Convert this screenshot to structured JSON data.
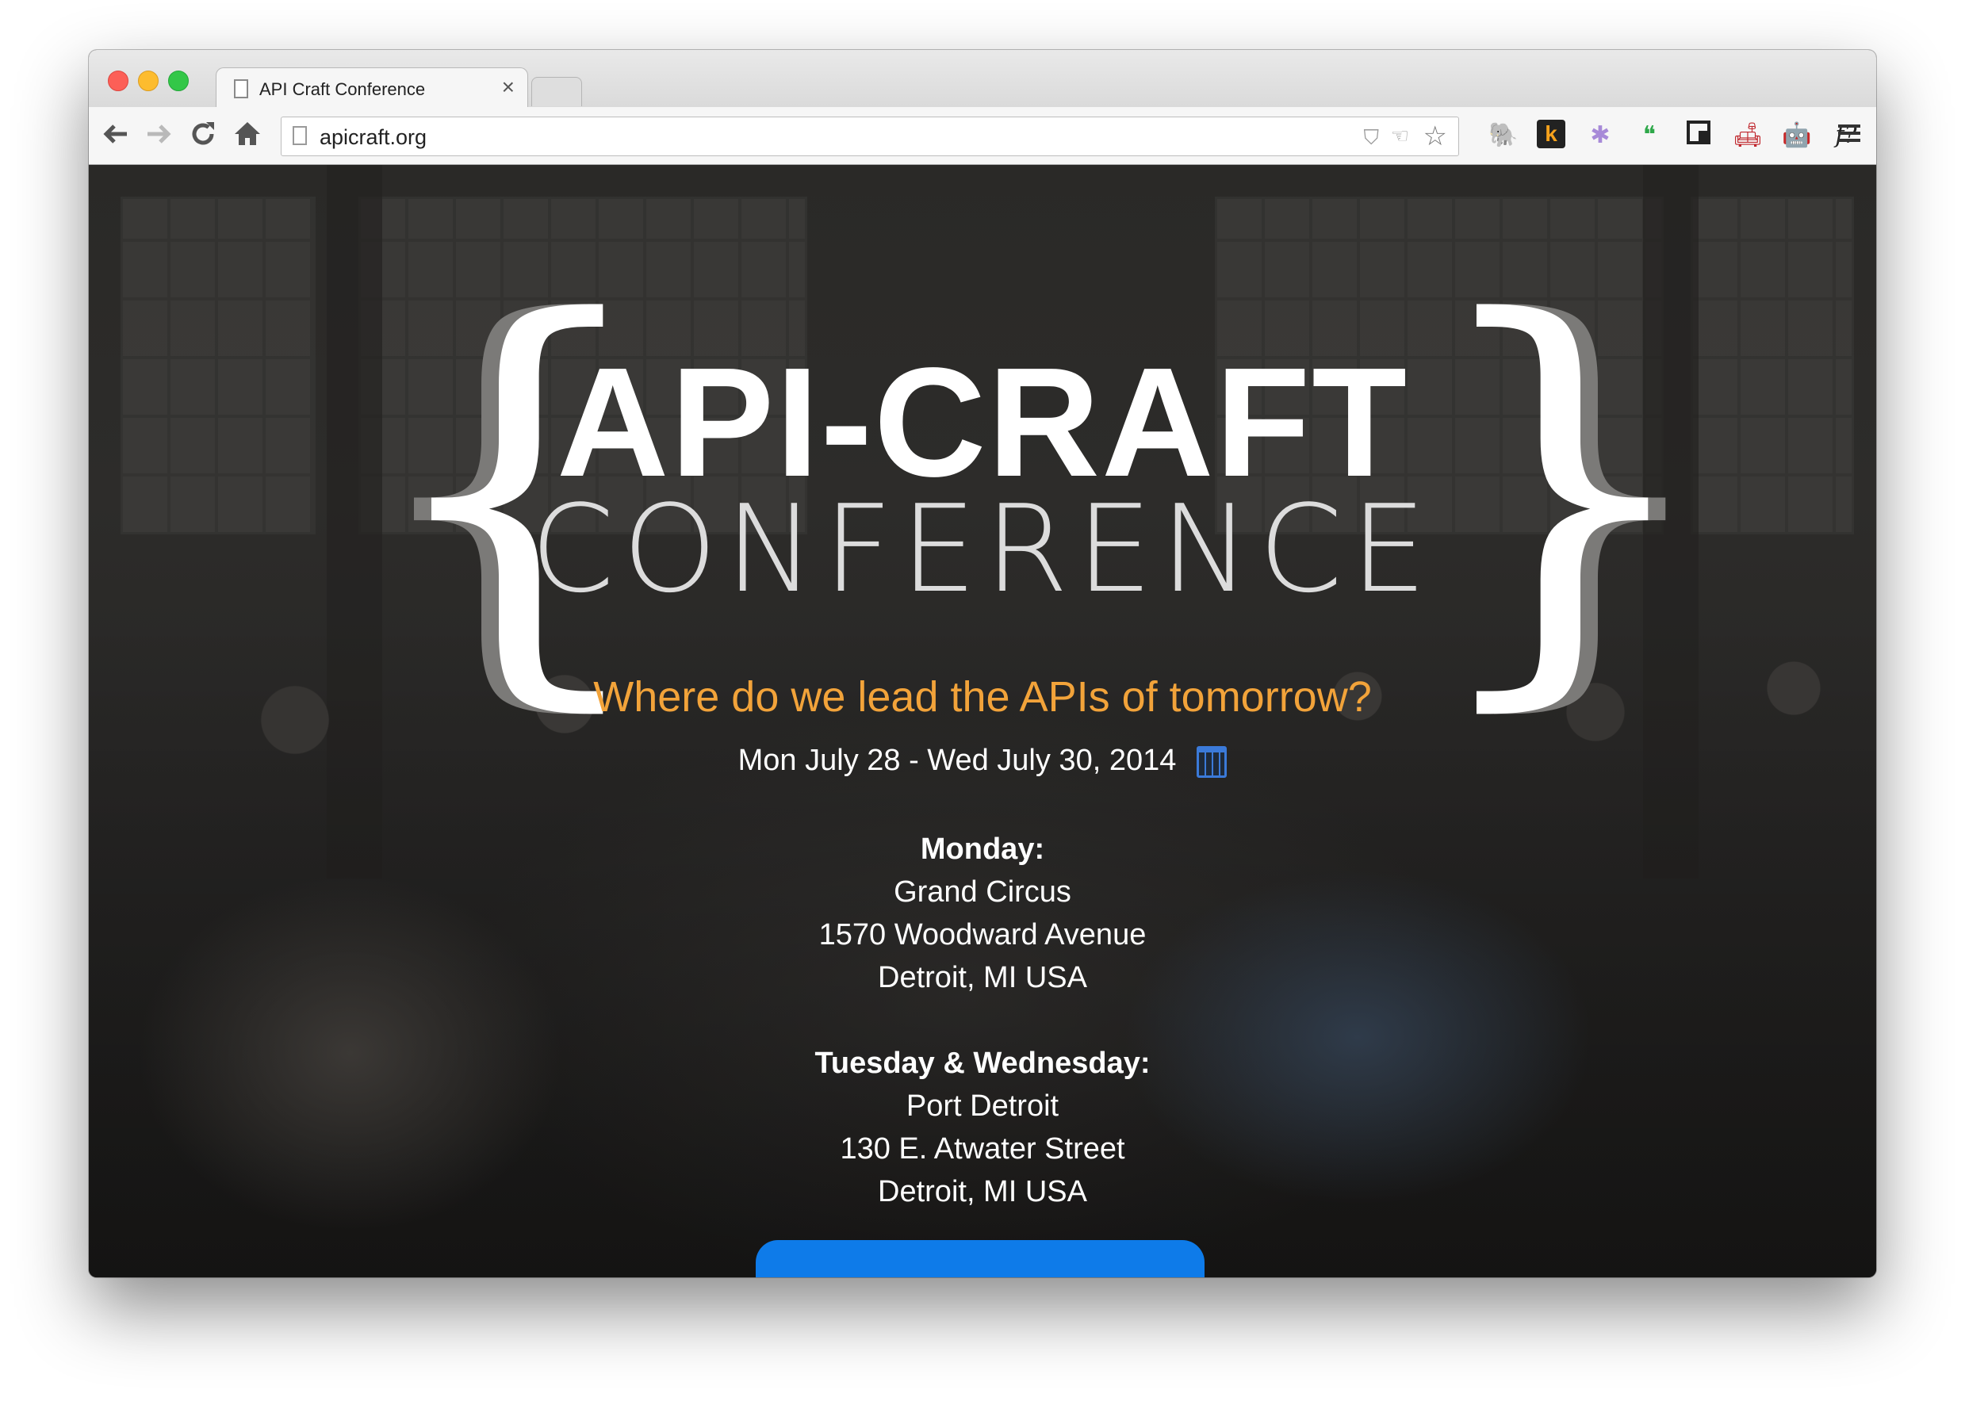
{
  "browser": {
    "tab_title": "API Craft Conference",
    "tab_close": "×",
    "url": "apicraft.org",
    "extensions": [
      "evernote-icon",
      "k-icon",
      "bug-icon",
      "hangouts-icon",
      "pip-icon",
      "couch-icon",
      "robot-icon",
      "fontface-icon",
      "menu-icon"
    ],
    "ext_glyphs": {
      "k": "k",
      "f": "f?"
    }
  },
  "hero": {
    "title_main": "API-CRAFT",
    "title_sub": "CONFERENCE",
    "brace_left": "{",
    "brace_right": "}",
    "tagline": "Where do we lead the APIs of tomorrow?",
    "dates": "Mon July 28 - Wed July 30, 2014"
  },
  "venues": [
    {
      "day": "Monday:",
      "name": "Grand Circus",
      "street": "1570 Woodward Avenue",
      "city": "Detroit, MI USA"
    },
    {
      "day": "Tuesday & Wednesday:",
      "name": "Port Detroit",
      "street": "130 E. Atwater Street",
      "city": "Detroit, MI USA"
    }
  ],
  "colors": {
    "accent": "#f2a33a",
    "cta": "#0e7be9",
    "calendar": "#3b7ad9"
  }
}
